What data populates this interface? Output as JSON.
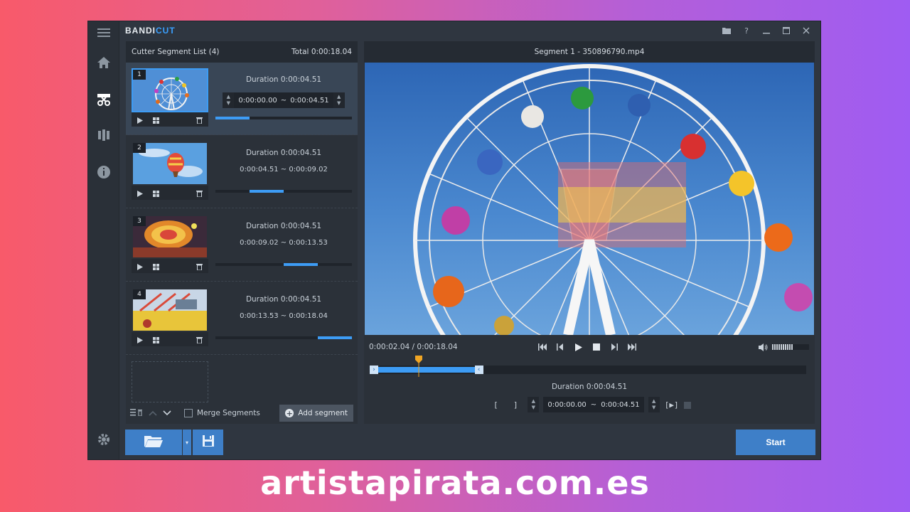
{
  "app": {
    "logo_main": "BANDI",
    "logo_cut": "CUT"
  },
  "colors": {
    "accent": "#3d9cf5",
    "panel": "#2b3139",
    "button": "#3e7fc8"
  },
  "rail": {
    "icons": [
      "menu-icon",
      "home-icon",
      "cutter-icon",
      "merge-icon",
      "info-icon",
      "settings-icon"
    ]
  },
  "window_buttons": [
    "folder-icon",
    "help-icon",
    "minimize-icon",
    "maximize-icon",
    "close-icon"
  ],
  "segment_list": {
    "title": "Cutter Segment List (4)",
    "total": "Total 0:00:18.04",
    "segments": [
      {
        "num": "1",
        "duration": "Duration 0:00:04.51",
        "start": "0:00:00.00",
        "sep": "~",
        "end": "0:00:04.51",
        "range": "0:00:00.00 ~ 0:00:04.51",
        "progress_start": 0.0,
        "progress_end": 0.25
      },
      {
        "num": "2",
        "duration": "Duration 0:00:04.51",
        "range": "0:00:04.51 ~ 0:00:09.02",
        "progress_start": 0.25,
        "progress_end": 0.5
      },
      {
        "num": "3",
        "duration": "Duration 0:00:04.51",
        "range": "0:00:09.02 ~ 0:00:13.53",
        "progress_start": 0.5,
        "progress_end": 0.75
      },
      {
        "num": "4",
        "duration": "Duration 0:00:04.51",
        "range": "0:00:13.53 ~ 0:00:18.04",
        "progress_start": 0.75,
        "progress_end": 1.0
      }
    ],
    "merge_label": "Merge Segments",
    "add_label": "Add segment"
  },
  "preview": {
    "title": "Segment 1 - 350896790.mp4",
    "time_readout": "0:00:02.04 / 0:00:18.04",
    "volume_level": 0.55,
    "timeline_selection": 0.25,
    "playhead_position": 0.113,
    "duration": "Duration 0:00:04.51",
    "start": "0:00:00.00",
    "sep": "~",
    "end": "0:00:04.51"
  },
  "bottom": {
    "start_label": "Start"
  },
  "watermark": "artistapirata.com.es"
}
